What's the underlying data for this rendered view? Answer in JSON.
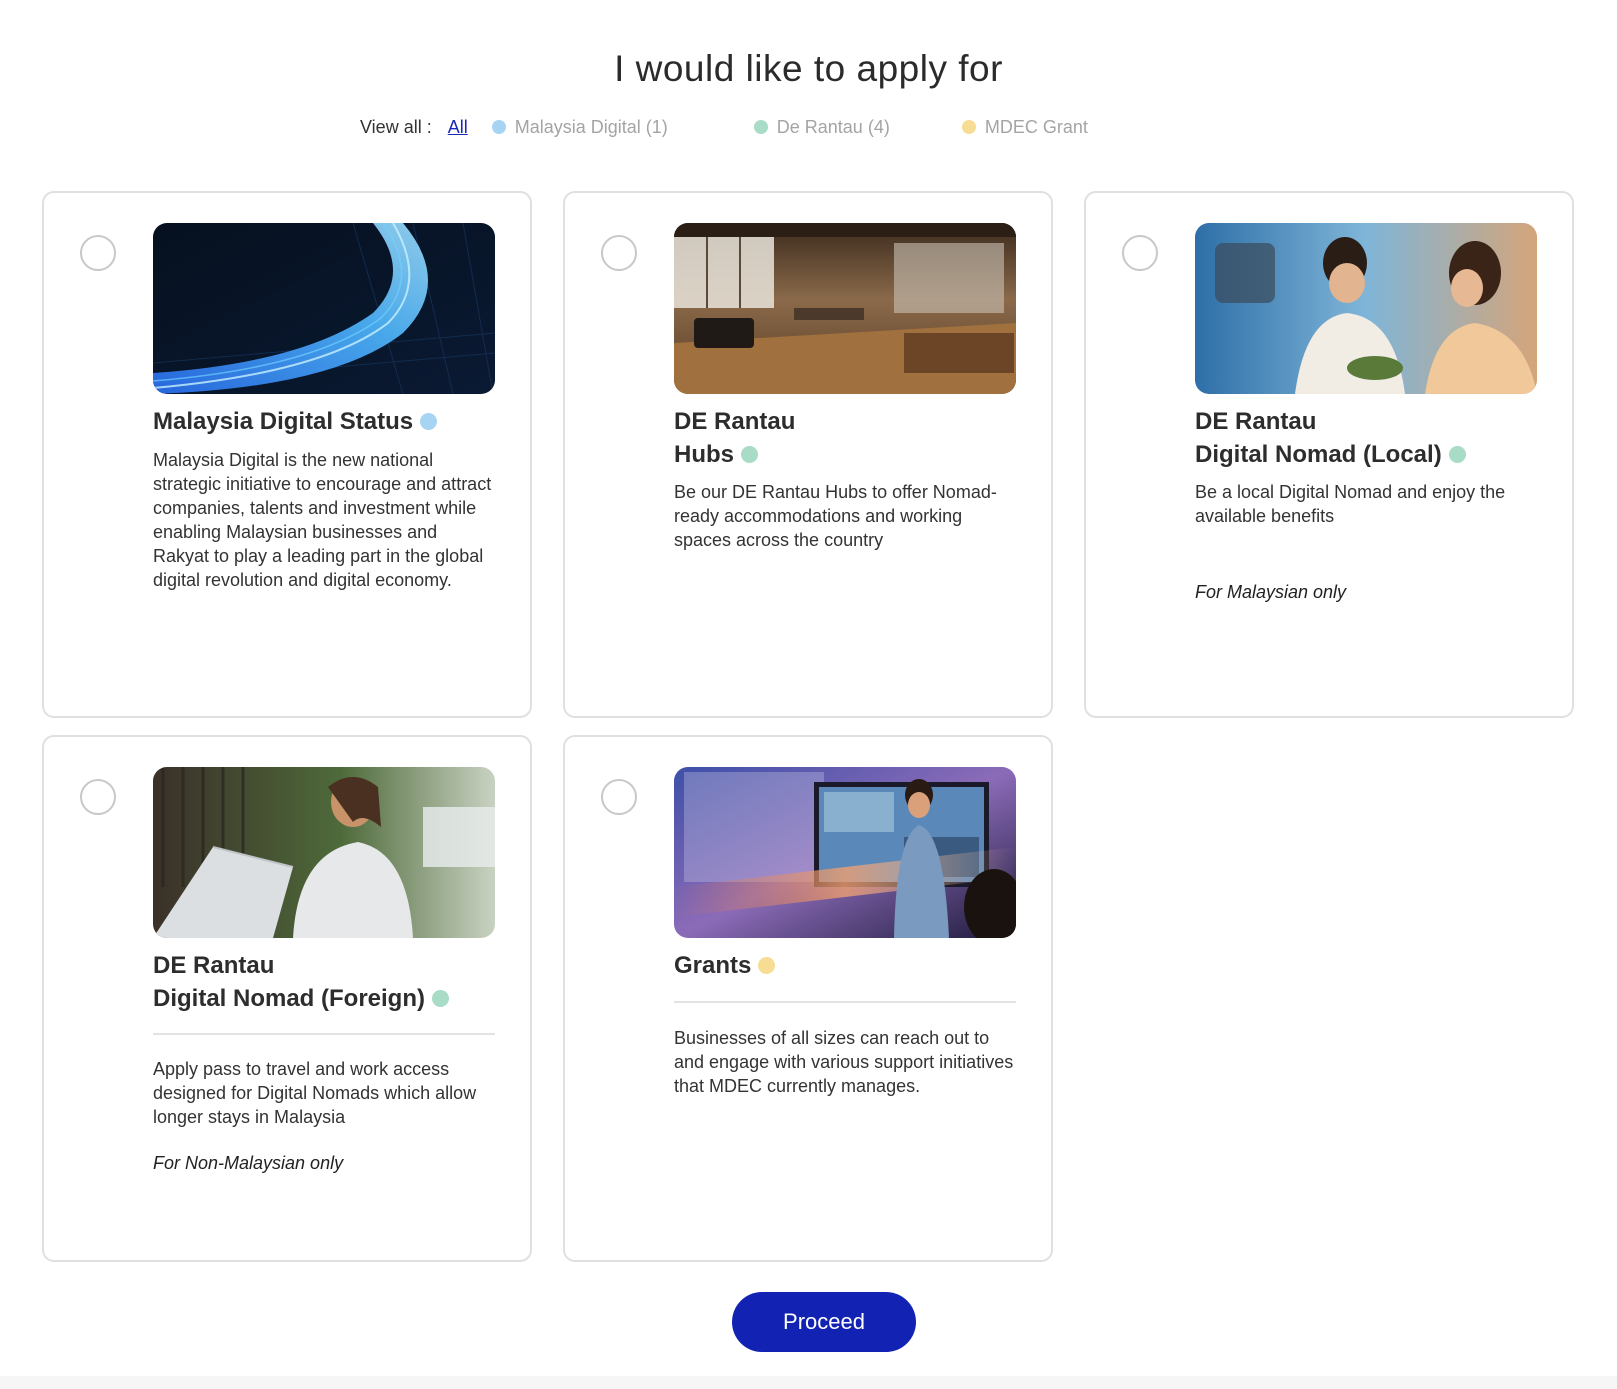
{
  "page": {
    "title": "I would like to apply for"
  },
  "filters": {
    "label": "View all :",
    "all_label": "All",
    "items": [
      {
        "label": "Malaysia Digital (1)",
        "color": "#a6d4f2"
      },
      {
        "label": "De Rantau (4)",
        "color": "#a8dcc6"
      },
      {
        "label": "MDEC Grant",
        "color": "#f7dc93"
      }
    ]
  },
  "colors": {
    "malaysia_digital": "#a6d4f2",
    "de_rantau": "#a8dcc6",
    "mdec_grant": "#f7dc93",
    "primary": "#1223b4"
  },
  "cards": [
    {
      "title_line1": "Malaysia Digital Status",
      "title_line2": "",
      "description": "Malaysia Digital is the new national strategic initiative to encourage and attract companies, talents and investment while enabling Malaysian businesses and Rakyat to play a leading part in the global digital revolution and digital economy.",
      "note": ""
    },
    {
      "title_line1": "DE Rantau",
      "title_line2": "Hubs",
      "description": "Be our DE Rantau Hubs to offer Nomad-ready accommodations and working spaces across the country",
      "note": ""
    },
    {
      "title_line1": "DE Rantau",
      "title_line2": "Digital Nomad (Local)",
      "description": "Be a local Digital Nomad and enjoy the available benefits",
      "note": "For Malaysian only"
    },
    {
      "title_line1": "DE Rantau",
      "title_line2": "Digital Nomad (Foreign)",
      "description": "Apply pass to travel and work access designed for Digital Nomads which allow longer stays in Malaysia",
      "note": "For Non-Malaysian only"
    },
    {
      "title_line1": "Grants",
      "title_line2": "",
      "description": "Businesses of all sizes can reach out to and engage with various support initiatives that MDEC currently manages.",
      "note": ""
    }
  ],
  "actions": {
    "proceed_label": "Proceed"
  }
}
